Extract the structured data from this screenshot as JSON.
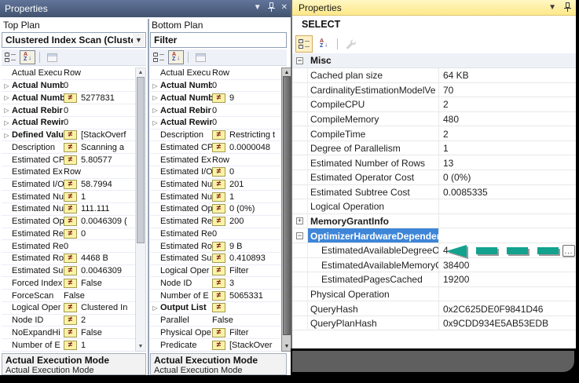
{
  "left_window": {
    "title": "Properties",
    "top_plan": {
      "label": "Top Plan",
      "selector": "Clustered Index Scan (Clustere",
      "footer_title": "Actual Execution Mode",
      "footer_desc": "Actual Execution Mode",
      "rows": [
        {
          "name": "Actual Execu",
          "value": "Row",
          "neq": false,
          "exp": false,
          "bold": false
        },
        {
          "name": "Actual Numb",
          "value": "0",
          "neq": false,
          "exp": true,
          "bold": true
        },
        {
          "name": "Actual Numb",
          "value": "5277831",
          "neq": true,
          "exp": true,
          "bold": true
        },
        {
          "name": "Actual Rebir",
          "value": "0",
          "neq": false,
          "exp": true,
          "bold": true
        },
        {
          "name": "Actual Rewir",
          "value": "0",
          "neq": false,
          "exp": true,
          "bold": true
        },
        {
          "name": "Defined Valu",
          "value": "[StackOverf",
          "neq": true,
          "exp": true,
          "bold": true
        },
        {
          "name": "Description",
          "value": "Scanning a",
          "neq": true,
          "exp": false,
          "bold": false
        },
        {
          "name": "Estimated CP",
          "value": "5.80577",
          "neq": true,
          "exp": false,
          "bold": false
        },
        {
          "name": "Estimated Ex",
          "value": "Row",
          "neq": false,
          "exp": false,
          "bold": false
        },
        {
          "name": "Estimated I/O",
          "value": "58.7994",
          "neq": true,
          "exp": false,
          "bold": false
        },
        {
          "name": "Estimated Nu",
          "value": "1",
          "neq": true,
          "exp": false,
          "bold": false
        },
        {
          "name": "Estimated Nu",
          "value": "111.111",
          "neq": true,
          "exp": false,
          "bold": false
        },
        {
          "name": "Estimated Op",
          "value": "0.0046309 (",
          "neq": true,
          "exp": false,
          "bold": false
        },
        {
          "name": "Estimated Re",
          "value": "0",
          "neq": true,
          "exp": false,
          "bold": false
        },
        {
          "name": "Estimated Re",
          "value": "0",
          "neq": false,
          "exp": false,
          "bold": false
        },
        {
          "name": "Estimated Ro",
          "value": "4468 B",
          "neq": true,
          "exp": false,
          "bold": false
        },
        {
          "name": "Estimated Su",
          "value": "0.0046309",
          "neq": true,
          "exp": false,
          "bold": false
        },
        {
          "name": "Forced Index",
          "value": "False",
          "neq": true,
          "exp": false,
          "bold": false
        },
        {
          "name": "ForceScan",
          "value": "False",
          "neq": false,
          "exp": false,
          "bold": false
        },
        {
          "name": "Logical Oper",
          "value": "Clustered In",
          "neq": true,
          "exp": false,
          "bold": false
        },
        {
          "name": "Node ID",
          "value": "2",
          "neq": true,
          "exp": false,
          "bold": false
        },
        {
          "name": "NoExpandHi",
          "value": "False",
          "neq": true,
          "exp": false,
          "bold": false
        },
        {
          "name": "Number of E",
          "value": "1",
          "neq": true,
          "exp": false,
          "bold": false
        }
      ]
    },
    "bottom_plan": {
      "label": "Bottom Plan",
      "selector": "Filter",
      "footer_title": "Actual Execution Mode",
      "footer_desc": "Actual Execution Mode",
      "rows": [
        {
          "name": "Actual Execu",
          "value": "Row",
          "neq": false,
          "exp": false,
          "bold": false
        },
        {
          "name": "Actual Numb",
          "value": "0",
          "neq": false,
          "exp": true,
          "bold": true
        },
        {
          "name": "Actual Numb",
          "value": "9",
          "neq": true,
          "exp": true,
          "bold": true
        },
        {
          "name": "Actual Rebir",
          "value": "0",
          "neq": false,
          "exp": true,
          "bold": true
        },
        {
          "name": "Actual Rewir",
          "value": "0",
          "neq": false,
          "exp": true,
          "bold": true
        },
        {
          "name": "Description",
          "value": "Restricting t",
          "neq": true,
          "exp": false,
          "bold": false
        },
        {
          "name": "Estimated CP",
          "value": "0.0000048",
          "neq": true,
          "exp": false,
          "bold": false
        },
        {
          "name": "Estimated Ex",
          "value": "Row",
          "neq": false,
          "exp": false,
          "bold": false
        },
        {
          "name": "Estimated I/O",
          "value": "0",
          "neq": true,
          "exp": false,
          "bold": false
        },
        {
          "name": "Estimated Nu",
          "value": "201",
          "neq": true,
          "exp": false,
          "bold": false
        },
        {
          "name": "Estimated Nu",
          "value": "1",
          "neq": true,
          "exp": false,
          "bold": false
        },
        {
          "name": "Estimated Op",
          "value": "0 (0%)",
          "neq": true,
          "exp": false,
          "bold": false
        },
        {
          "name": "Estimated Re",
          "value": "200",
          "neq": true,
          "exp": false,
          "bold": false
        },
        {
          "name": "Estimated Re",
          "value": "0",
          "neq": false,
          "exp": false,
          "bold": false
        },
        {
          "name": "Estimated Ro",
          "value": "9 B",
          "neq": true,
          "exp": false,
          "bold": false
        },
        {
          "name": "Estimated Su",
          "value": "0.410893",
          "neq": true,
          "exp": false,
          "bold": false
        },
        {
          "name": "Logical Oper",
          "value": "Filter",
          "neq": true,
          "exp": false,
          "bold": false
        },
        {
          "name": "Node ID",
          "value": "3",
          "neq": true,
          "exp": false,
          "bold": false
        },
        {
          "name": "Number of E",
          "value": "5065331",
          "neq": true,
          "exp": false,
          "bold": false
        },
        {
          "name": "Output List",
          "value": "",
          "neq": true,
          "exp": true,
          "bold": true
        },
        {
          "name": "Parallel",
          "value": "False",
          "neq": false,
          "exp": false,
          "bold": false
        },
        {
          "name": "Physical Ope",
          "value": "Filter",
          "neq": true,
          "exp": false,
          "bold": false
        },
        {
          "name": "Predicate",
          "value": "[StackOver",
          "neq": true,
          "exp": false,
          "bold": false
        }
      ]
    }
  },
  "right_window": {
    "title": "Properties",
    "object_name": "SELECT",
    "category": "Misc",
    "ellipsis_label": "...",
    "rows": [
      {
        "name": "Cached plan size",
        "value": "64 KB"
      },
      {
        "name": "CardinalityEstimationModelVe",
        "value": "70"
      },
      {
        "name": "CompileCPU",
        "value": "2"
      },
      {
        "name": "CompileMemory",
        "value": "480"
      },
      {
        "name": "CompileTime",
        "value": "2"
      },
      {
        "name": "Degree of Parallelism",
        "value": "1"
      },
      {
        "name": "Estimated Number of Rows",
        "value": "13"
      },
      {
        "name": "Estimated Operator Cost",
        "value": "0 (0%)"
      },
      {
        "name": "Estimated Subtree Cost",
        "value": "0.0085335"
      },
      {
        "name": "Logical Operation",
        "value": ""
      },
      {
        "name": "MemoryGrantInfo",
        "value": "",
        "bold": true,
        "expand": "plus"
      },
      {
        "name": "OptimizerHardwareDependent",
        "value": "",
        "bold": true,
        "expand": "minus",
        "selected": true
      },
      {
        "name": "EstimatedAvailableDegreeOf",
        "value": "4",
        "indent": true
      },
      {
        "name": "EstimatedAvailableMemoryG",
        "value": "38400",
        "indent": true
      },
      {
        "name": "EstimatedPagesCached",
        "value": "19200",
        "indent": true
      },
      {
        "name": "Physical Operation",
        "value": ""
      },
      {
        "name": "QueryHash",
        "value": "0x2C625DE0F9841D46"
      },
      {
        "name": "QueryPlanHash",
        "value": "0x9CDD934E5AB53EDB"
      }
    ],
    "annotation_color": "#12a28e",
    "selection_color": "#3e86d8"
  }
}
